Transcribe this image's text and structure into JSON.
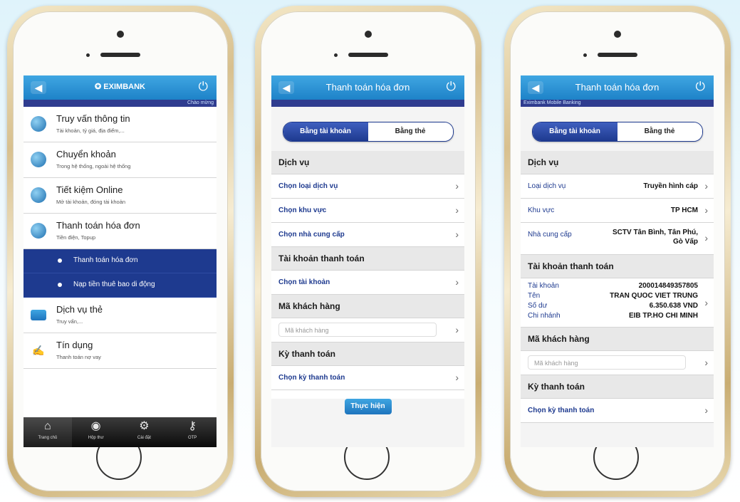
{
  "phone1": {
    "brand": "EXIMBANK",
    "subbar": "Chào mừng",
    "menu": [
      {
        "title": "Truy vấn thông tin",
        "subtitle": "Tài khoản, tỷ giá, địa điểm,..."
      },
      {
        "title": "Chuyển khoản",
        "subtitle": "Trong hệ thống, ngoài hệ thống"
      },
      {
        "title": "Tiết kiệm Online",
        "subtitle": "Mở tài khoản, đóng tài khoản"
      },
      {
        "title": "Thanh toán hóa đơn",
        "subtitle": "Tiền điện, Topup"
      }
    ],
    "submenu": [
      "Thanh toán hóa đơn",
      "Nạp tiền thuê bao di động"
    ],
    "menu2": [
      {
        "title": "Dịch vụ thẻ",
        "subtitle": "Truy vấn,..."
      },
      {
        "title": "Tín dụng",
        "subtitle": "Thanh toán nợ vay"
      }
    ],
    "tabs": [
      "Trang chủ",
      "Hộp thư",
      "Cài đặt",
      "OTP"
    ]
  },
  "phone2": {
    "title": "Thanh toán hóa đơn",
    "seg": [
      "Bằng tài khoản",
      "Bằng thẻ"
    ],
    "sec_service": "Dịch vụ",
    "rows_service": [
      "Chọn loại dịch vụ",
      "Chọn khu vực",
      "Chọn nhà cung cấp"
    ],
    "sec_account": "Tài khoản thanh toán",
    "row_account": "Chọn tài khoản",
    "sec_customer": "Mã khách hàng",
    "customer_placeholder": "Mã khách hàng",
    "sec_period": "Kỳ thanh toán",
    "row_period": "Chọn kỳ thanh toán",
    "submit": "Thực hiện"
  },
  "phone3": {
    "title": "Thanh toán hóa đơn",
    "subbar": "Eximbank Mobile Banking",
    "seg": [
      "Bằng tài khoản",
      "Bằng thẻ"
    ],
    "sec_service": "Dịch vụ",
    "service_rows": [
      {
        "label": "Loại dịch vụ",
        "value": "Truyền hình cáp"
      },
      {
        "label": "Khu vực",
        "value": "TP HCM"
      },
      {
        "label": "Nhà cung cấp",
        "value": "SCTV Tân Bình, Tân Phú, Gò Vấp"
      }
    ],
    "sec_account": "Tài khoản thanh toán",
    "account": [
      {
        "label": "Tài khoản",
        "value": "200014849357805"
      },
      {
        "label": "Tên",
        "value": "TRAN QUOC VIET TRUNG"
      },
      {
        "label": "Số dư",
        "value": "6.350.638 VND"
      },
      {
        "label": "Chi nhánh",
        "value": "EIB TP.HO CHI MINH"
      }
    ],
    "sec_customer": "Mã khách hàng",
    "customer_placeholder": "Mã khách hàng",
    "sec_period": "Kỳ thanh toán",
    "row_period": "Chọn kỳ thanh toán"
  },
  "icons": {
    "back": "back-arrow-icon",
    "power": "power-icon",
    "chevron": "chevron-right-icon"
  },
  "colors": {
    "header": "#2a8fd4",
    "nav_dark": "#1e3a8f",
    "section_bg": "#e8e8e8"
  }
}
